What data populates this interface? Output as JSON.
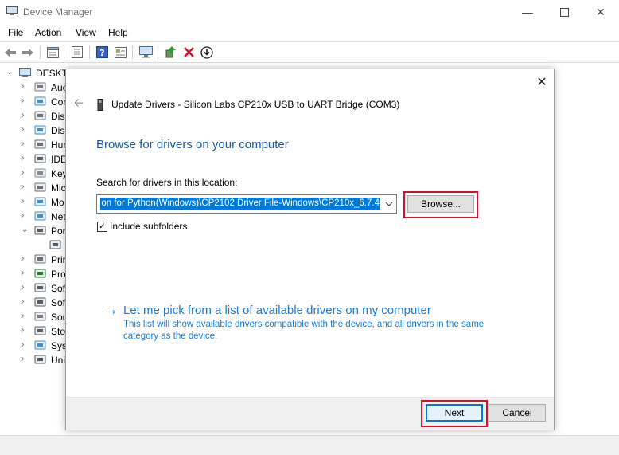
{
  "window": {
    "title": "Device Manager",
    "icons": {
      "app": "device-manager-icon",
      "minimize": "minimize-icon",
      "maximize": "maximize-icon",
      "close": "close-icon"
    }
  },
  "menu": [
    "File",
    "Action",
    "View",
    "Help"
  ],
  "toolbar": [
    "back-arrow-icon",
    "forward-arrow-icon",
    "properties-icon",
    "sheet-icon",
    "help-icon",
    "view-icon",
    "monitor-icon",
    "update-driver-icon",
    "uninstall-x-icon",
    "download-icon"
  ],
  "tree": {
    "root": "DESKTO",
    "items": [
      {
        "label": "Auc",
        "icon": "speaker-icon",
        "expander": "›"
      },
      {
        "label": "Cor",
        "icon": "monitor-icon",
        "expander": "›"
      },
      {
        "label": "Disl",
        "icon": "disk-icon",
        "expander": "›"
      },
      {
        "label": "Disp",
        "icon": "display-icon",
        "expander": "›"
      },
      {
        "label": "Hur",
        "icon": "hid-icon",
        "expander": "›"
      },
      {
        "label": "IDE",
        "icon": "ide-icon",
        "expander": "›"
      },
      {
        "label": "Key",
        "icon": "keyboard-icon",
        "expander": "›"
      },
      {
        "label": "Mic",
        "icon": "mouse-icon",
        "expander": "›"
      },
      {
        "label": "Mo",
        "icon": "monitor-icon",
        "expander": "›"
      },
      {
        "label": "Net",
        "icon": "network-icon",
        "expander": "›"
      },
      {
        "label": "Por",
        "icon": "port-icon",
        "expander": "⌄"
      },
      {
        "label": "",
        "icon": "port-device-icon",
        "expander": ""
      },
      {
        "label": "Prir",
        "icon": "printer-icon",
        "expander": "›"
      },
      {
        "label": "Pro",
        "icon": "processor-icon",
        "expander": "›"
      },
      {
        "label": "Sof",
        "icon": "software-icon",
        "expander": "›"
      },
      {
        "label": "Sof",
        "icon": "software-icon",
        "expander": "›"
      },
      {
        "label": "Sou",
        "icon": "sound-icon",
        "expander": "›"
      },
      {
        "label": "Sto",
        "icon": "storage-icon",
        "expander": "›"
      },
      {
        "label": "Sys",
        "icon": "system-icon",
        "expander": "›"
      },
      {
        "label": "Uni",
        "icon": "usb-icon",
        "expander": "›"
      }
    ]
  },
  "dialog": {
    "title": "Update Drivers - Silicon Labs CP210x USB to UART Bridge (COM3)",
    "heading": "Browse for drivers on your computer",
    "search_label": "Search for drivers in this location:",
    "path_value": "on for Python(Windows)\\CP2102 Driver File-Windows\\CP210x_6.7.4",
    "browse_label": "Browse...",
    "include_subfolders_label": "Include subfolders",
    "include_subfolders_checked": true,
    "pick_link": "Let me pick from a list of available drivers on my computer",
    "pick_desc": "This list will show available drivers compatible with the device, and all drivers in the same category as the device.",
    "next_label": "Next",
    "cancel_label": "Cancel"
  },
  "colors": {
    "link": "#1c7bd6",
    "heading": "#1c5aa6",
    "highlight": "#d4112a",
    "selection": "#0078d7"
  }
}
